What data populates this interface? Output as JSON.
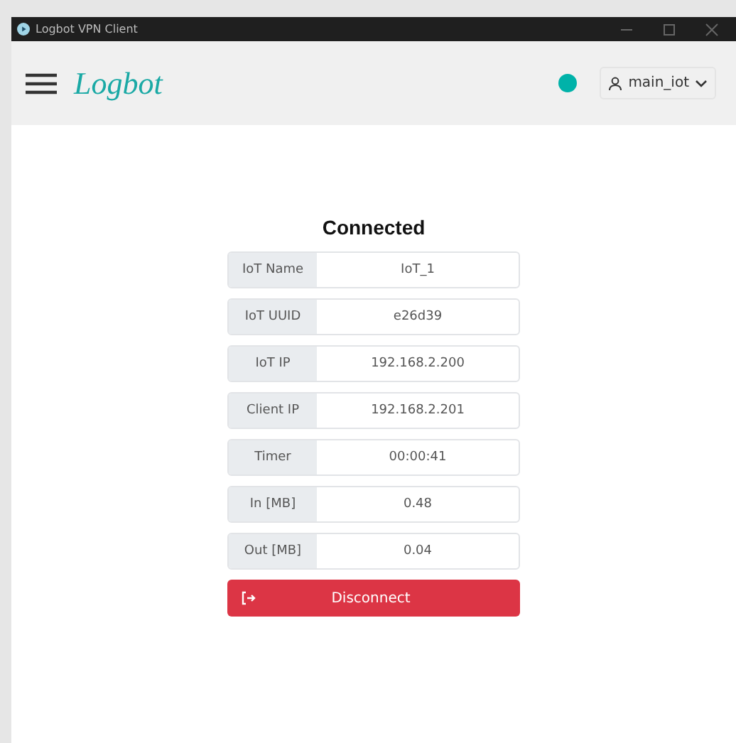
{
  "window": {
    "title": "Logbot VPN Client"
  },
  "header": {
    "logo": "Logbot",
    "status": {
      "connected": true,
      "color": "#00b2a9"
    },
    "user": "main_iot"
  },
  "status_title": "Connected",
  "rows": [
    {
      "label": "IoT Name",
      "value": "IoT_1"
    },
    {
      "label": "IoT UUID",
      "value": "e26d39"
    },
    {
      "label": "IoT IP",
      "value": "192.168.2.200"
    },
    {
      "label": "Client IP",
      "value": "192.168.2.201"
    },
    {
      "label": "Timer",
      "value": "00:00:41"
    },
    {
      "label": "In [MB]",
      "value": "0.48"
    },
    {
      "label": "Out [MB]",
      "value": "0.04"
    }
  ],
  "disconnect_button": "Disconnect"
}
